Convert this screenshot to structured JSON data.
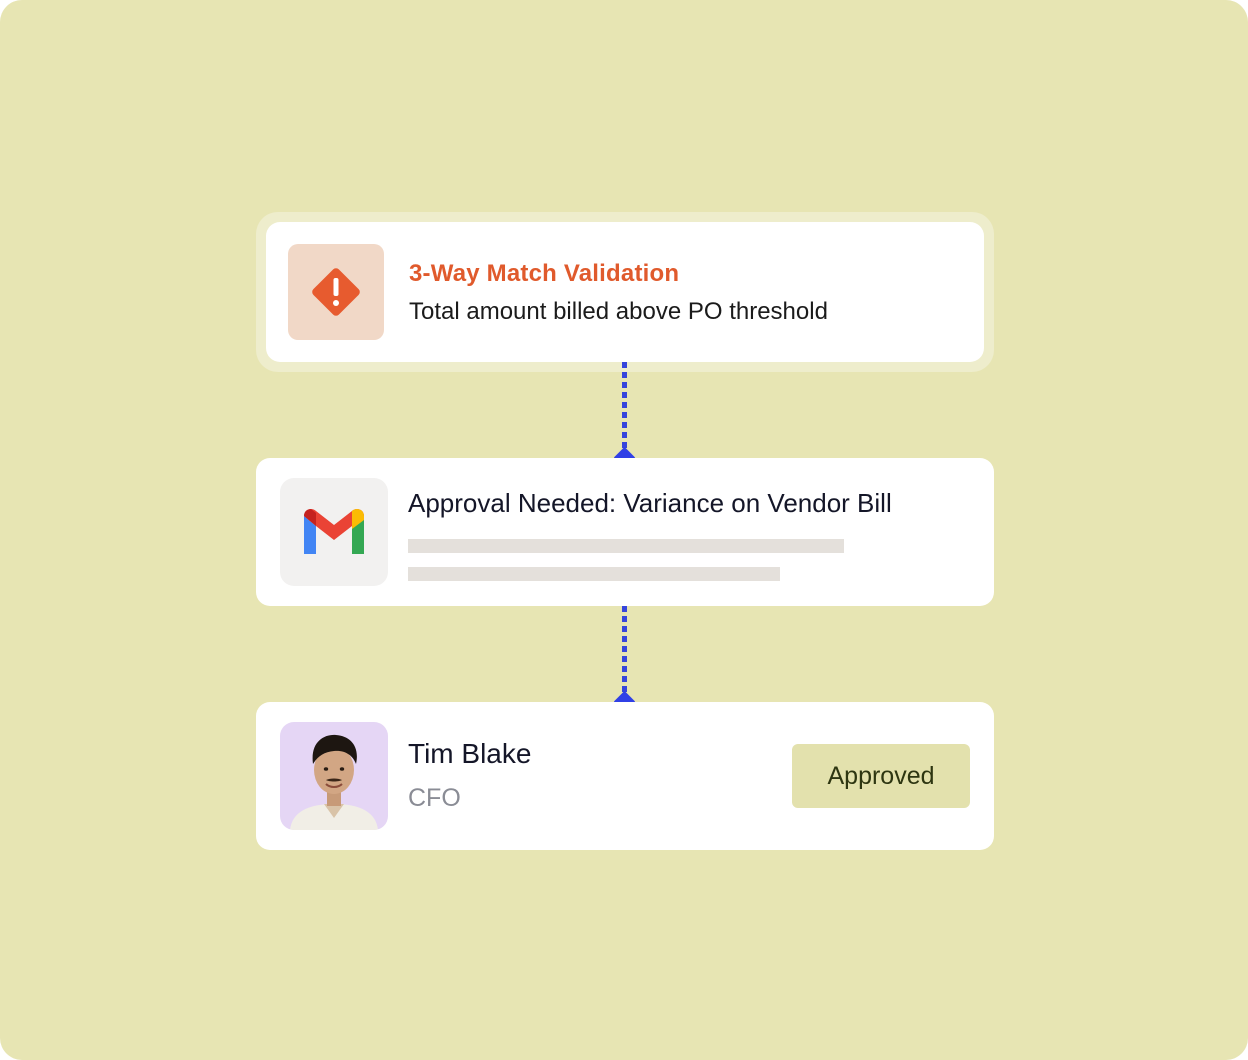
{
  "validation_card": {
    "icon": "warning-diamond-icon",
    "title": "3-Way Match Validation",
    "subtitle": "Total amount billed above PO threshold",
    "accent_color": "#e05a2c"
  },
  "email_card": {
    "icon": "gmail-icon",
    "title": "Approval Needed: Variance on Vendor Bill"
  },
  "approver_card": {
    "name": "Tim Blake",
    "role": "CFO",
    "status": "Approved"
  },
  "colors": {
    "background": "#e7e5b3",
    "connector": "#3040e6",
    "badge": "#e3e1ad"
  }
}
